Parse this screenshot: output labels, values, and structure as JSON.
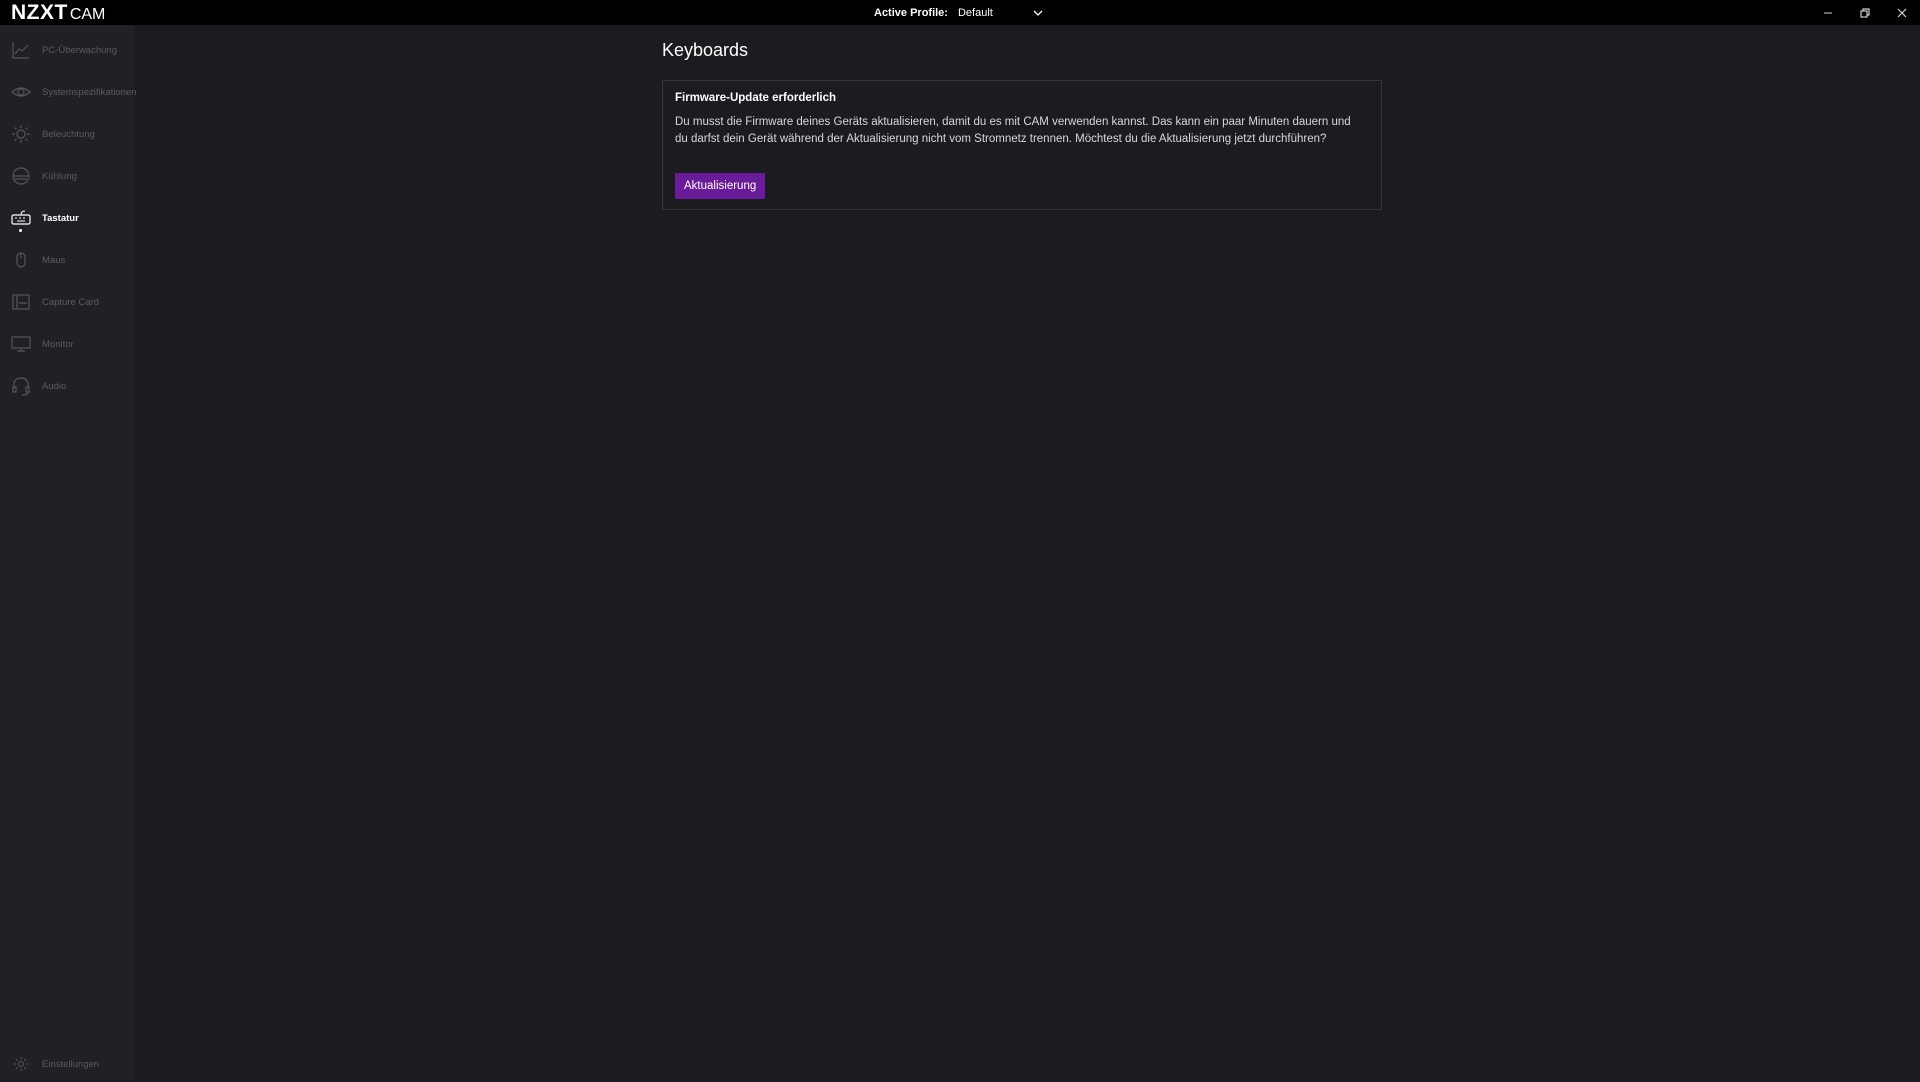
{
  "app": {
    "brand": "NZXT",
    "product": "CAM"
  },
  "titlebar": {
    "profile_label": "Active Profile:",
    "profile_value": "Default"
  },
  "sidebar": {
    "items": [
      {
        "label": "PC-Überwachung",
        "icon": "chart-line-icon"
      },
      {
        "label": "Systemspezifikationen",
        "icon": "eye-icon"
      },
      {
        "label": "Beleuchtung",
        "icon": "sun-icon"
      },
      {
        "label": "Kühlung",
        "icon": "cooler-icon"
      },
      {
        "label": "Tastatur",
        "icon": "keyboard-icon",
        "active": true
      },
      {
        "label": "Maus",
        "icon": "mouse-icon"
      },
      {
        "label": "Capture Card",
        "icon": "capture-card-icon"
      },
      {
        "label": "Monitor",
        "icon": "monitor-icon"
      },
      {
        "label": "Audio",
        "icon": "headset-icon"
      }
    ],
    "settings_label": "Einstellungen"
  },
  "main": {
    "title": "Keyboards",
    "card": {
      "title": "Firmware-Update erforderlich",
      "body": "Du musst die Firmware deines Geräts aktualisieren, damit du es mit CAM verwenden kannst. Das kann ein paar Minuten dauern und du darfst dein Gerät während der Aktualisierung nicht vom Stromnetz trennen. Möchtest du die Aktualisierung jetzt durchführen?",
      "button_label": "Aktualisierung"
    }
  },
  "colors": {
    "accent": "#6a1b9a",
    "background": "#1b1c1f",
    "sidebar": "#202124",
    "titlebar": "#000000"
  }
}
